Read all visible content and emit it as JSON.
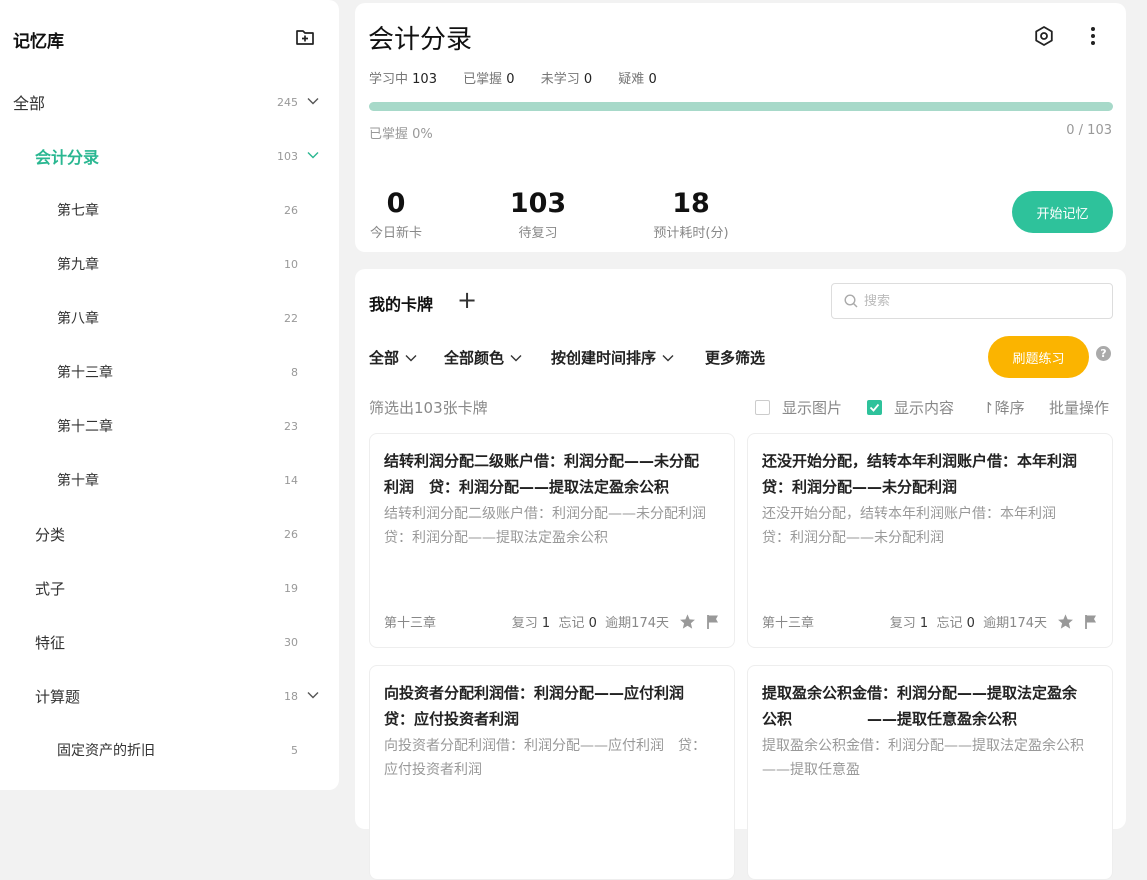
{
  "sidebar": {
    "title": "记忆库",
    "items": [
      {
        "label": "全部",
        "count": "245"
      },
      {
        "label": "会计分录",
        "count": "103"
      },
      {
        "label": "第七章",
        "count": "26"
      },
      {
        "label": "第九章",
        "count": "10"
      },
      {
        "label": "第八章",
        "count": "22"
      },
      {
        "label": "第十三章",
        "count": "8"
      },
      {
        "label": "第十二章",
        "count": "23"
      },
      {
        "label": "第十章",
        "count": "14"
      },
      {
        "label": "分类",
        "count": "26"
      },
      {
        "label": "式子",
        "count": "19"
      },
      {
        "label": "特征",
        "count": "30"
      },
      {
        "label": "计算题",
        "count": "18"
      },
      {
        "label": "固定资产的折旧",
        "count": "5"
      }
    ]
  },
  "deck": {
    "title": "会计分录",
    "stats": {
      "learning_label": "学习中",
      "learning": "103",
      "mastered_label": "已掌握",
      "mastered": "0",
      "unlearned_label": "未学习",
      "unlearned": "0",
      "hard_label": "疑难",
      "hard": "0"
    },
    "progress_label": "已掌握 0%",
    "progress_value": 0,
    "progress_ratio": "0 / 103",
    "new_today": "0",
    "new_today_label": "今日新卡",
    "to_review": "103",
    "to_review_label": "待复习",
    "est_time": "18",
    "est_time_label": "预计耗时(分)",
    "start_label": "开始记忆"
  },
  "cards_panel": {
    "title": "我的卡牌",
    "search_placeholder": "搜索",
    "filters": {
      "all": "全部",
      "color": "全部颜色",
      "sort": "按创建时间排序",
      "more": "更多筛选"
    },
    "drill_label": "刷题练习",
    "help": "?",
    "result_count": "筛选出103张卡牌",
    "show_image": "显示图片",
    "show_content": "显示内容",
    "desc_sort": "↾降序",
    "batch": "批量操作"
  },
  "cards": [
    {
      "question": "结转利润分配二级账户借：利润分配——未分配利润　贷：利润分配——提取法定盈余公积",
      "answer": "结转利润分配二级账户借：利润分配——未分配利润　贷：利润分配——提取法定盈余公积",
      "deck": "第十三章",
      "review_label": "复习",
      "review": "1",
      "forget_label": "忘记",
      "forget": "0",
      "overdue": "逾期174天"
    },
    {
      "question": "还没开始分配，结转本年利润账户借：本年利润　贷：利润分配——未分配利润",
      "answer": "还没开始分配，结转本年利润账户借：本年利润　贷：利润分配——未分配利润",
      "deck": "第十三章",
      "review_label": "复习",
      "review": "1",
      "forget_label": "忘记",
      "forget": "0",
      "overdue": "逾期174天"
    },
    {
      "question": "向投资者分配利润借：利润分配——应付利润　贷：应付投资者利润",
      "answer": "向投资者分配利润借：利润分配——应付利润　贷：应付投资者利润",
      "deck": "",
      "review_label": "",
      "review": "",
      "forget_label": "",
      "forget": "",
      "overdue": ""
    },
    {
      "question": "提取盈余公积金借：利润分配——提取法定盈余公积　　　　　——提取任意盈余公积",
      "answer": "提取盈余公积金借：利润分配——提取法定盈余公积　　　　　——提取任意盈",
      "deck": "",
      "review_label": "",
      "review": "",
      "forget_label": "",
      "forget": "",
      "overdue": ""
    }
  ],
  "colors": {
    "accent": "#2ec29b",
    "accent_text": "#2ab791",
    "drill": "#fbb400",
    "progress_track": "#a7d9c9"
  }
}
